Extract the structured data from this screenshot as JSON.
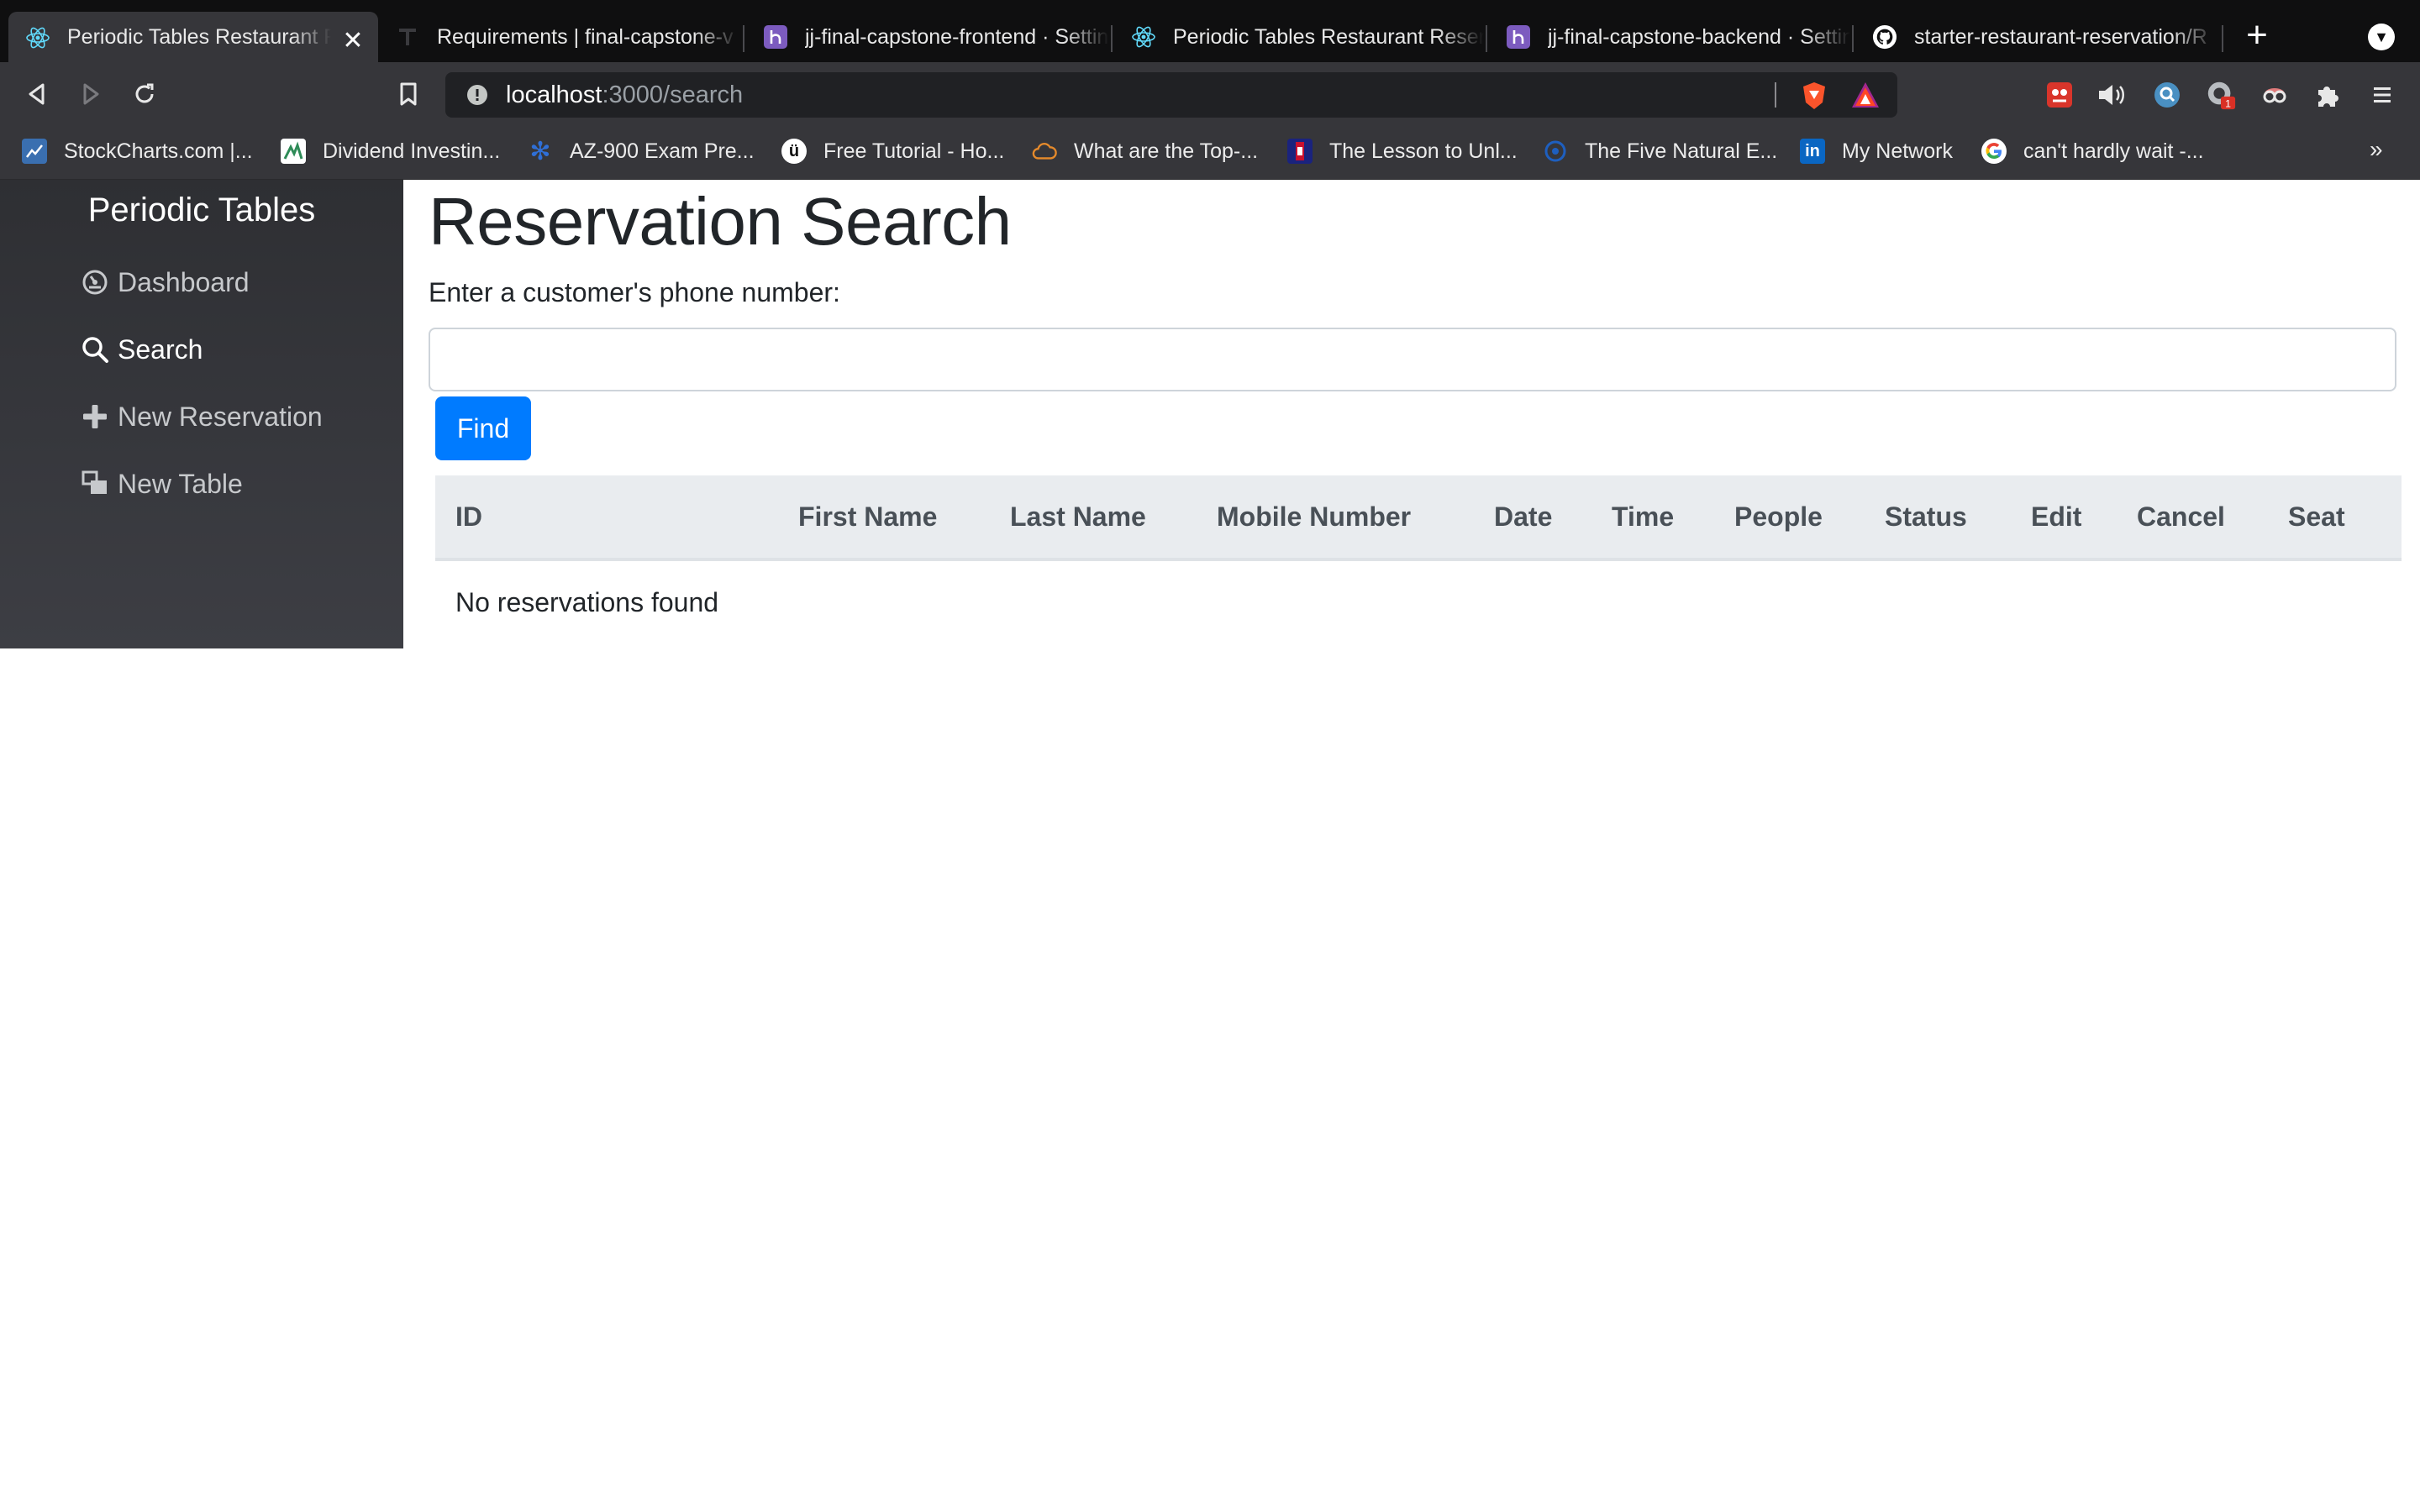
{
  "browser": {
    "tabs": [
      {
        "title": "Periodic Tables Restaurant Reservation System",
        "icon": "react-icon",
        "active": true
      },
      {
        "title": "Requirements | final-capstone-v",
        "icon": "thinkful-icon",
        "active": false
      },
      {
        "title": "jj-final-capstone-frontend · Settings",
        "icon": "heroku-icon",
        "active": false
      },
      {
        "title": "Periodic Tables Restaurant Reservation",
        "icon": "react-icon",
        "active": false
      },
      {
        "title": "jj-final-capstone-backend · Settings",
        "icon": "heroku-icon",
        "active": false
      },
      {
        "title": "starter-restaurant-reservation/R",
        "icon": "github-icon",
        "active": false
      }
    ],
    "url_host": "localhost",
    "url_path": ":3000/search",
    "bookmarks": [
      {
        "label": "StockCharts.com |...",
        "icon": "stockcharts-icon",
        "color": "#3a6fb0"
      },
      {
        "label": "Dividend Investin...",
        "icon": "dividend-icon",
        "color": "#2e8b57"
      },
      {
        "label": "AZ-900 Exam Pre...",
        "icon": "snowflake-icon",
        "color": "#2f6fd6"
      },
      {
        "label": "Free Tutorial - Ho...",
        "icon": "udemy-icon",
        "color": "#ffffff"
      },
      {
        "label": "What are the Top-...",
        "icon": "cloud-icon",
        "color": "#e58a2b"
      },
      {
        "label": "The Lesson to Unl...",
        "icon": "lesson-icon",
        "color": "#c8102e"
      },
      {
        "label": "The Five Natural E...",
        "icon": "circle-icon",
        "color": "#1e5fbf"
      },
      {
        "label": "My Network",
        "icon": "linkedin-icon",
        "color": "#0a66c2"
      },
      {
        "label": "can't hardly wait -...",
        "icon": "google-icon",
        "color": "#ffffff"
      }
    ],
    "more_label": "»"
  },
  "app": {
    "brand": "Periodic Tables",
    "nav": [
      {
        "label": "Dashboard",
        "icon": "dashboard-icon"
      },
      {
        "label": "Search",
        "icon": "search-icon"
      },
      {
        "label": "New Reservation",
        "icon": "plus-icon"
      },
      {
        "label": "New Table",
        "icon": "table-icon"
      }
    ],
    "active_nav": "Search"
  },
  "search": {
    "title": "Reservation Search",
    "label": "Enter a customer's phone number:",
    "input_value": "",
    "button_label": "Find"
  },
  "table": {
    "columns": [
      "ID",
      "First Name",
      "Last Name",
      "Mobile Number",
      "Date",
      "Time",
      "People",
      "Status",
      "Edit",
      "Cancel",
      "Seat"
    ],
    "empty_message": "No reservations found"
  },
  "colors": {
    "primary_button": "#007bff",
    "sidebar_bg": "#35363b",
    "table_header_bg": "#e9ecef"
  }
}
